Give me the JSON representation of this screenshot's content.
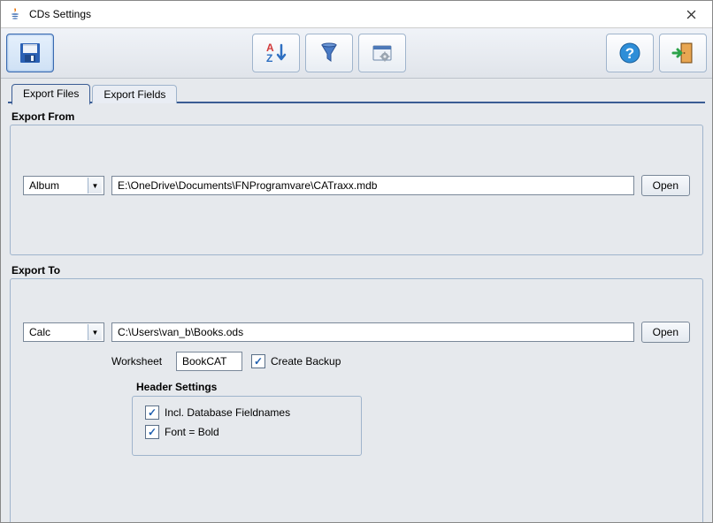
{
  "window": {
    "title": "CDs Settings"
  },
  "tabs": {
    "files": "Export Files",
    "fields": "Export Fields"
  },
  "export_from": {
    "label": "Export From",
    "type": "Album",
    "path": "E:\\OneDrive\\Documents\\FNProgramvare\\CATraxx.mdb",
    "open": "Open"
  },
  "export_to": {
    "label": "Export To",
    "type": "Calc",
    "path": "C:\\Users\\van_b\\Books.ods",
    "open": "Open",
    "worksheet_label": "Worksheet",
    "worksheet": "BookCAT",
    "create_backup": "Create Backup",
    "header_settings_label": "Header Settings",
    "incl_fieldnames": "Incl. Database Fieldnames",
    "font_bold": "Font = Bold"
  }
}
